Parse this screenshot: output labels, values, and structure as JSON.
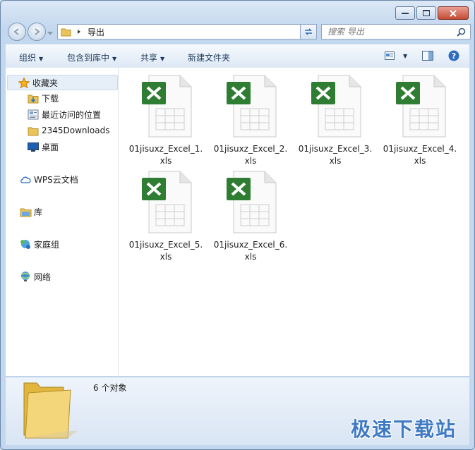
{
  "address": {
    "path": "导出"
  },
  "search": {
    "placeholder": "搜索 导出"
  },
  "toolbar": {
    "organize": "组织",
    "include_library": "包含到库中",
    "share": "共享",
    "new_folder": "新建文件夹"
  },
  "sidebar": {
    "favorites": "收藏夹",
    "items": [
      {
        "label": "下载"
      },
      {
        "label": "最近访问的位置"
      },
      {
        "label": "2345Downloads"
      },
      {
        "label": "桌面"
      }
    ],
    "wps": "WPS云文档",
    "library": "库",
    "homegroup": "家庭组",
    "network": "网络"
  },
  "files": [
    {
      "name": "01jisuxz_Excel_1.xls",
      "icon": "excel-file-icon"
    },
    {
      "name": "01jisuxz_Excel_2.xls",
      "icon": "excel-file-icon"
    },
    {
      "name": "01jisuxz_Excel_3.xls",
      "icon": "excel-file-icon"
    },
    {
      "name": "01jisuxz_Excel_4.xls",
      "icon": "excel-file-icon"
    },
    {
      "name": "01jisuxz_Excel_5.xls",
      "icon": "excel-file-icon"
    },
    {
      "name": "01jisuxz_Excel_6.xls",
      "icon": "excel-file-icon"
    }
  ],
  "status": {
    "count": "6 个对象"
  },
  "watermark": "极速下载站",
  "colors": {
    "excel_green": "#2f7d32",
    "accent": "#3f7ac4"
  }
}
